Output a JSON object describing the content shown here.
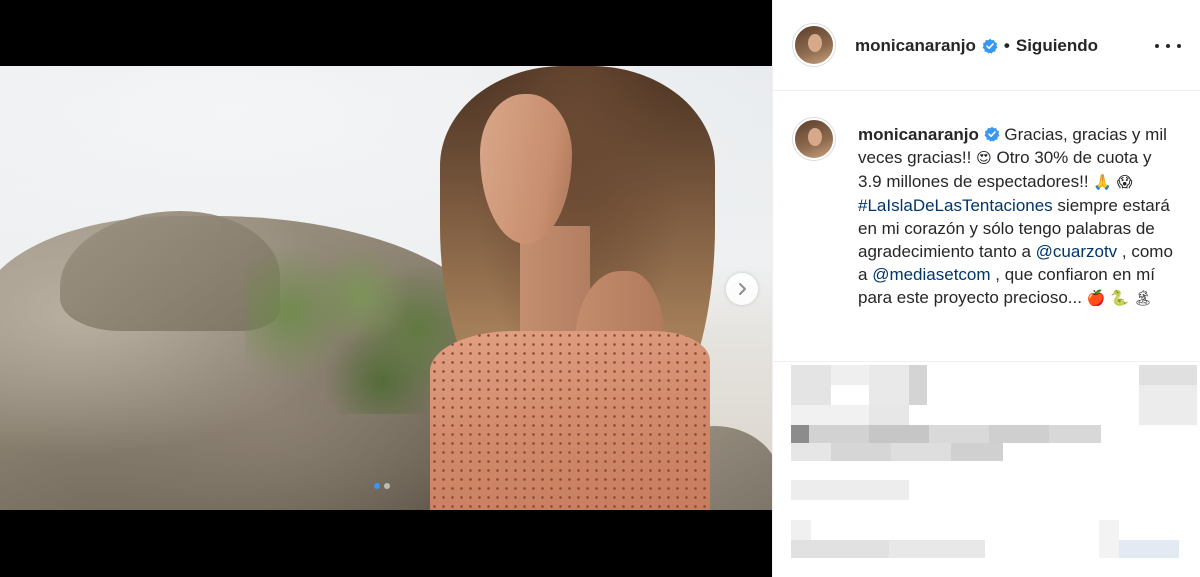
{
  "post": {
    "username": "monicanaranjo",
    "verified": true,
    "separator": "•",
    "follow_status": "Siguiendo",
    "caption": {
      "part1": "Gracias, gracias y mil veces gracias!! ",
      "emoji1": "😍",
      "part2": "  Otro 30% de cuota y 3.9 millones de espectadores!! ",
      "emoji2": "🙏",
      "emoji3": "😱",
      "hashtag": "#LaIslaDeLasTentaciones",
      "part3": " siempre estará en mi corazón y sólo tengo palabras de agradecimiento tanto a ",
      "mention1": "@cuarzotv",
      "part4": " , como a ",
      "mention2": "@mediasetcom",
      "part5": " , que confiaron en mí para este proyecto precioso... ",
      "emoji4": "🍎",
      "emoji5": "🐍",
      "emoji6": "🏝"
    }
  },
  "carousel": {
    "slide_count": 2,
    "active_index": 0,
    "next_icon": "chevron-right-icon"
  },
  "colors": {
    "accent": "#3897f0",
    "link": "#003569",
    "text": "#262626",
    "divider": "#efefef"
  }
}
